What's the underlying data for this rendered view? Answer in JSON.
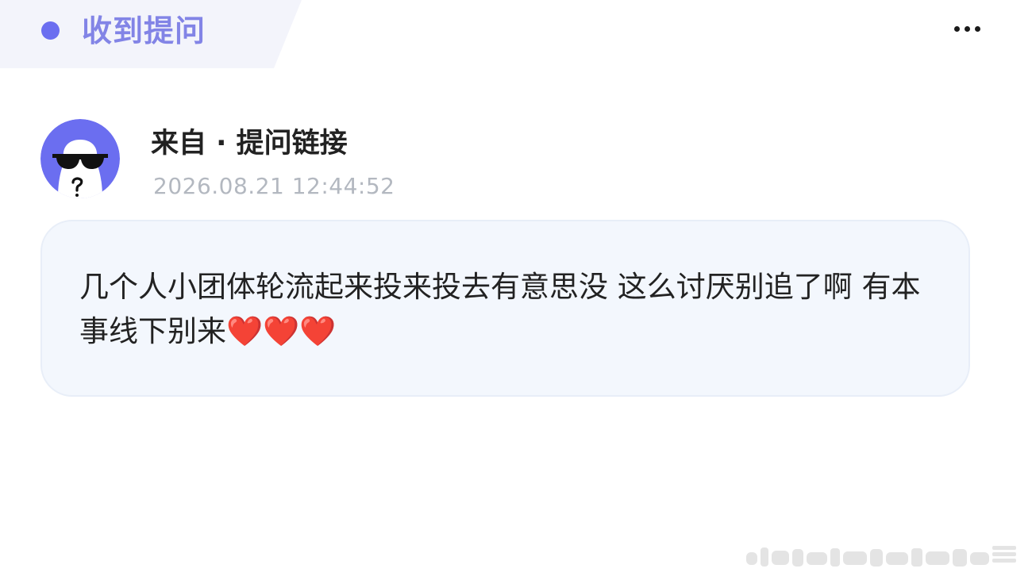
{
  "header": {
    "title": "收到提问",
    "dot_color": "#6b6ef0",
    "title_color": "#8284e6",
    "more_icon": "more-horizontal-icon"
  },
  "sender": {
    "name": "来自 · 提问链接",
    "timestamp": "2026.08.21 12:44:52",
    "avatar_icon": "anonymous-sunglasses-avatar-icon",
    "avatar_color": "#6b6ef0"
  },
  "question": {
    "line1": "几个人小团体轮流起来投来投去有意思没 这么讨厌别",
    "line2": "追了啊 有本事线下别来",
    "hearts": "❤️❤️❤️",
    "bubble_color": "#f3f7fd"
  },
  "colors": {
    "text_primary": "#222222",
    "text_secondary": "#b3b8c0"
  }
}
